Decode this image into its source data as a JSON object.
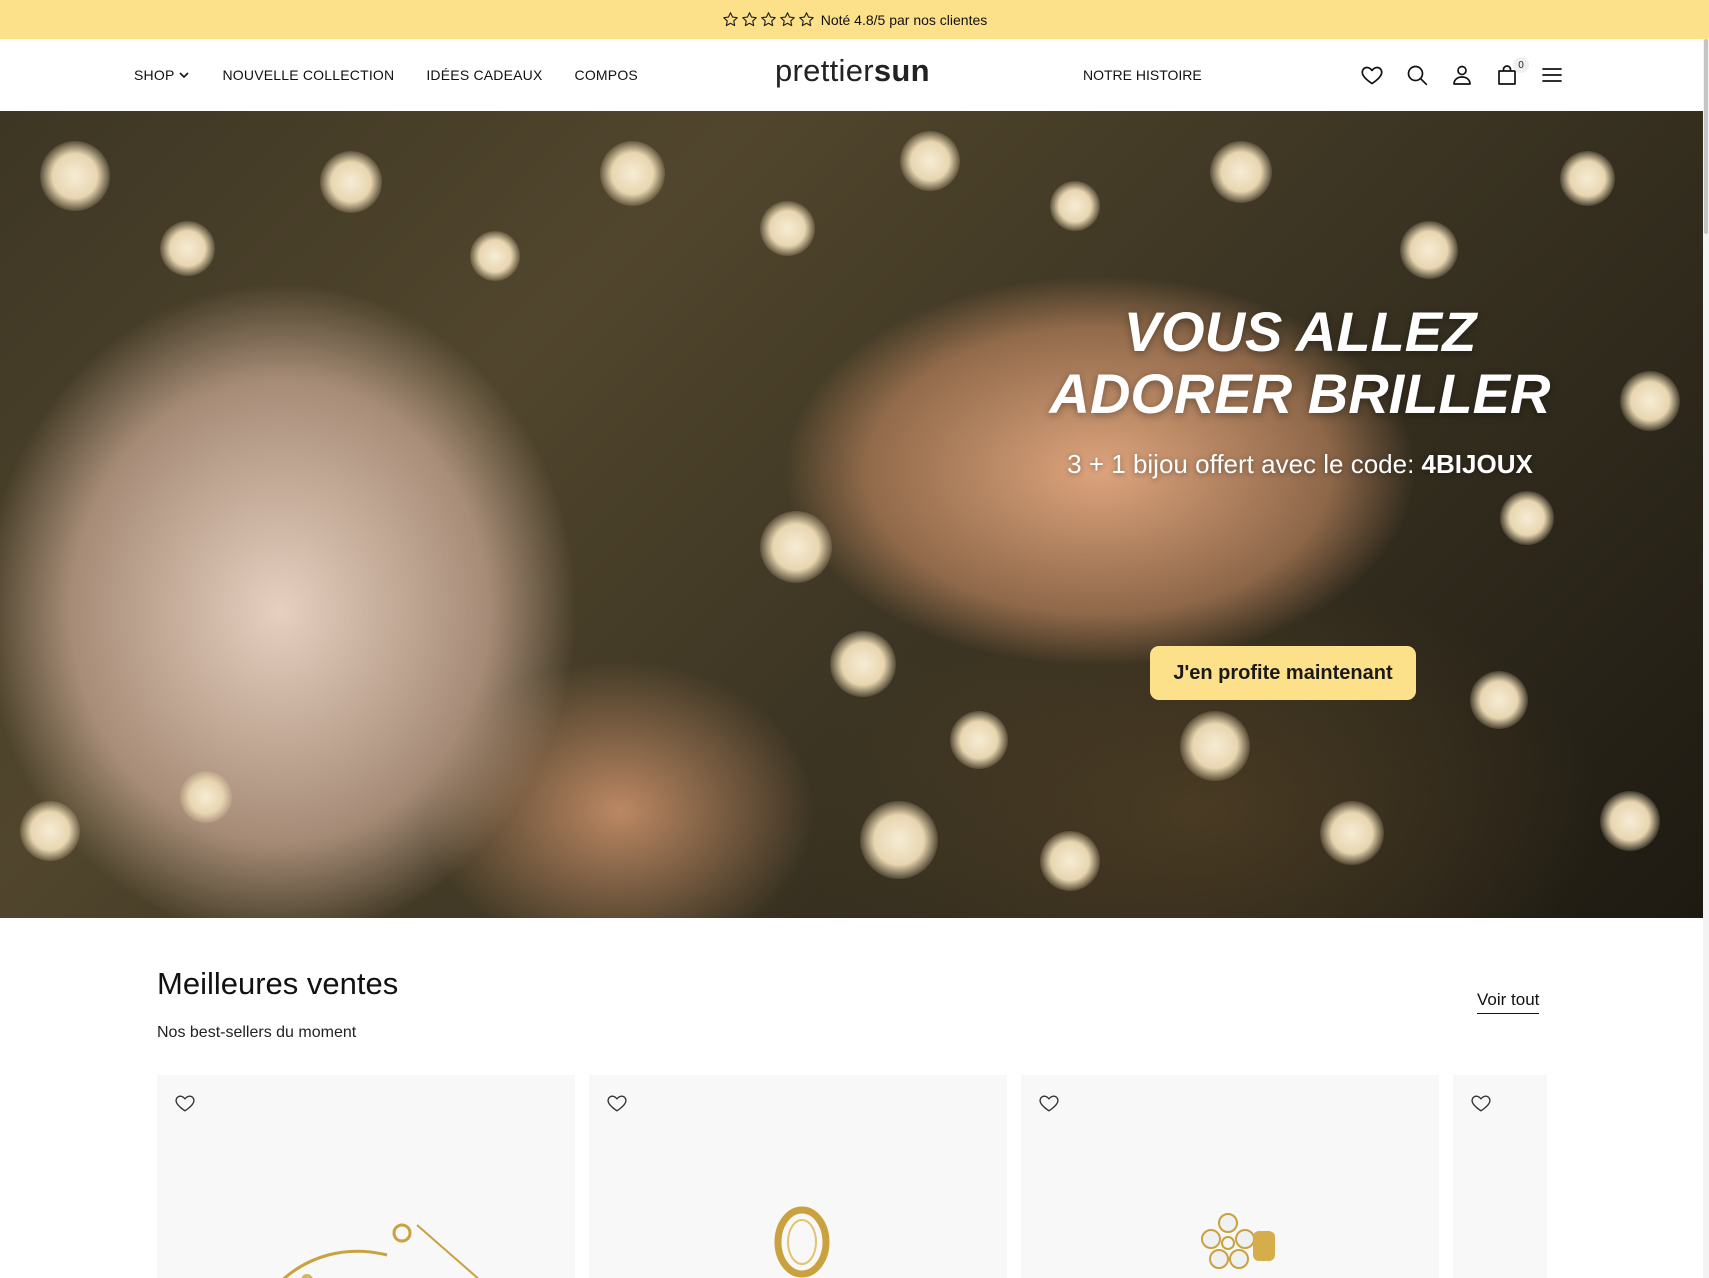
{
  "announcement": {
    "text": "Noté 4.8/5 par nos clientes",
    "stars": 5
  },
  "header": {
    "nav_left": [
      {
        "label": "SHOP",
        "has_dropdown": true
      },
      {
        "label": "NOUVELLE COLLECTION"
      },
      {
        "label": "IDÉES CADEAUX"
      },
      {
        "label": "COMPOS"
      }
    ],
    "logo": {
      "light": "prettier",
      "bold": "sun"
    },
    "nav_right": {
      "label": "NOTRE HISTOIRE"
    },
    "cart_count": "0",
    "icons": [
      "heart-icon",
      "search-icon",
      "user-icon",
      "bag-icon",
      "menu-icon"
    ]
  },
  "hero": {
    "title_line1": "VOUS ALLEZ",
    "title_line2": "ADORER BRILLER",
    "subtitle_prefix": "3 + 1 bijou offert avec le code: ",
    "subtitle_code": "4BIJOUX",
    "cta": "J'en profite maintenant"
  },
  "bestsellers": {
    "title": "Meilleures ventes",
    "subtitle": "Nos best-sellers du moment",
    "see_all": "Voir tout",
    "products": [
      {
        "kind": "chain-earring"
      },
      {
        "kind": "hoop-earring"
      },
      {
        "kind": "star-stud-earring"
      },
      {
        "kind": "product-partial"
      }
    ]
  },
  "colors": {
    "accent_yellow": "#fde08a",
    "text": "#111111",
    "card_bg": "#f8f8f8"
  }
}
